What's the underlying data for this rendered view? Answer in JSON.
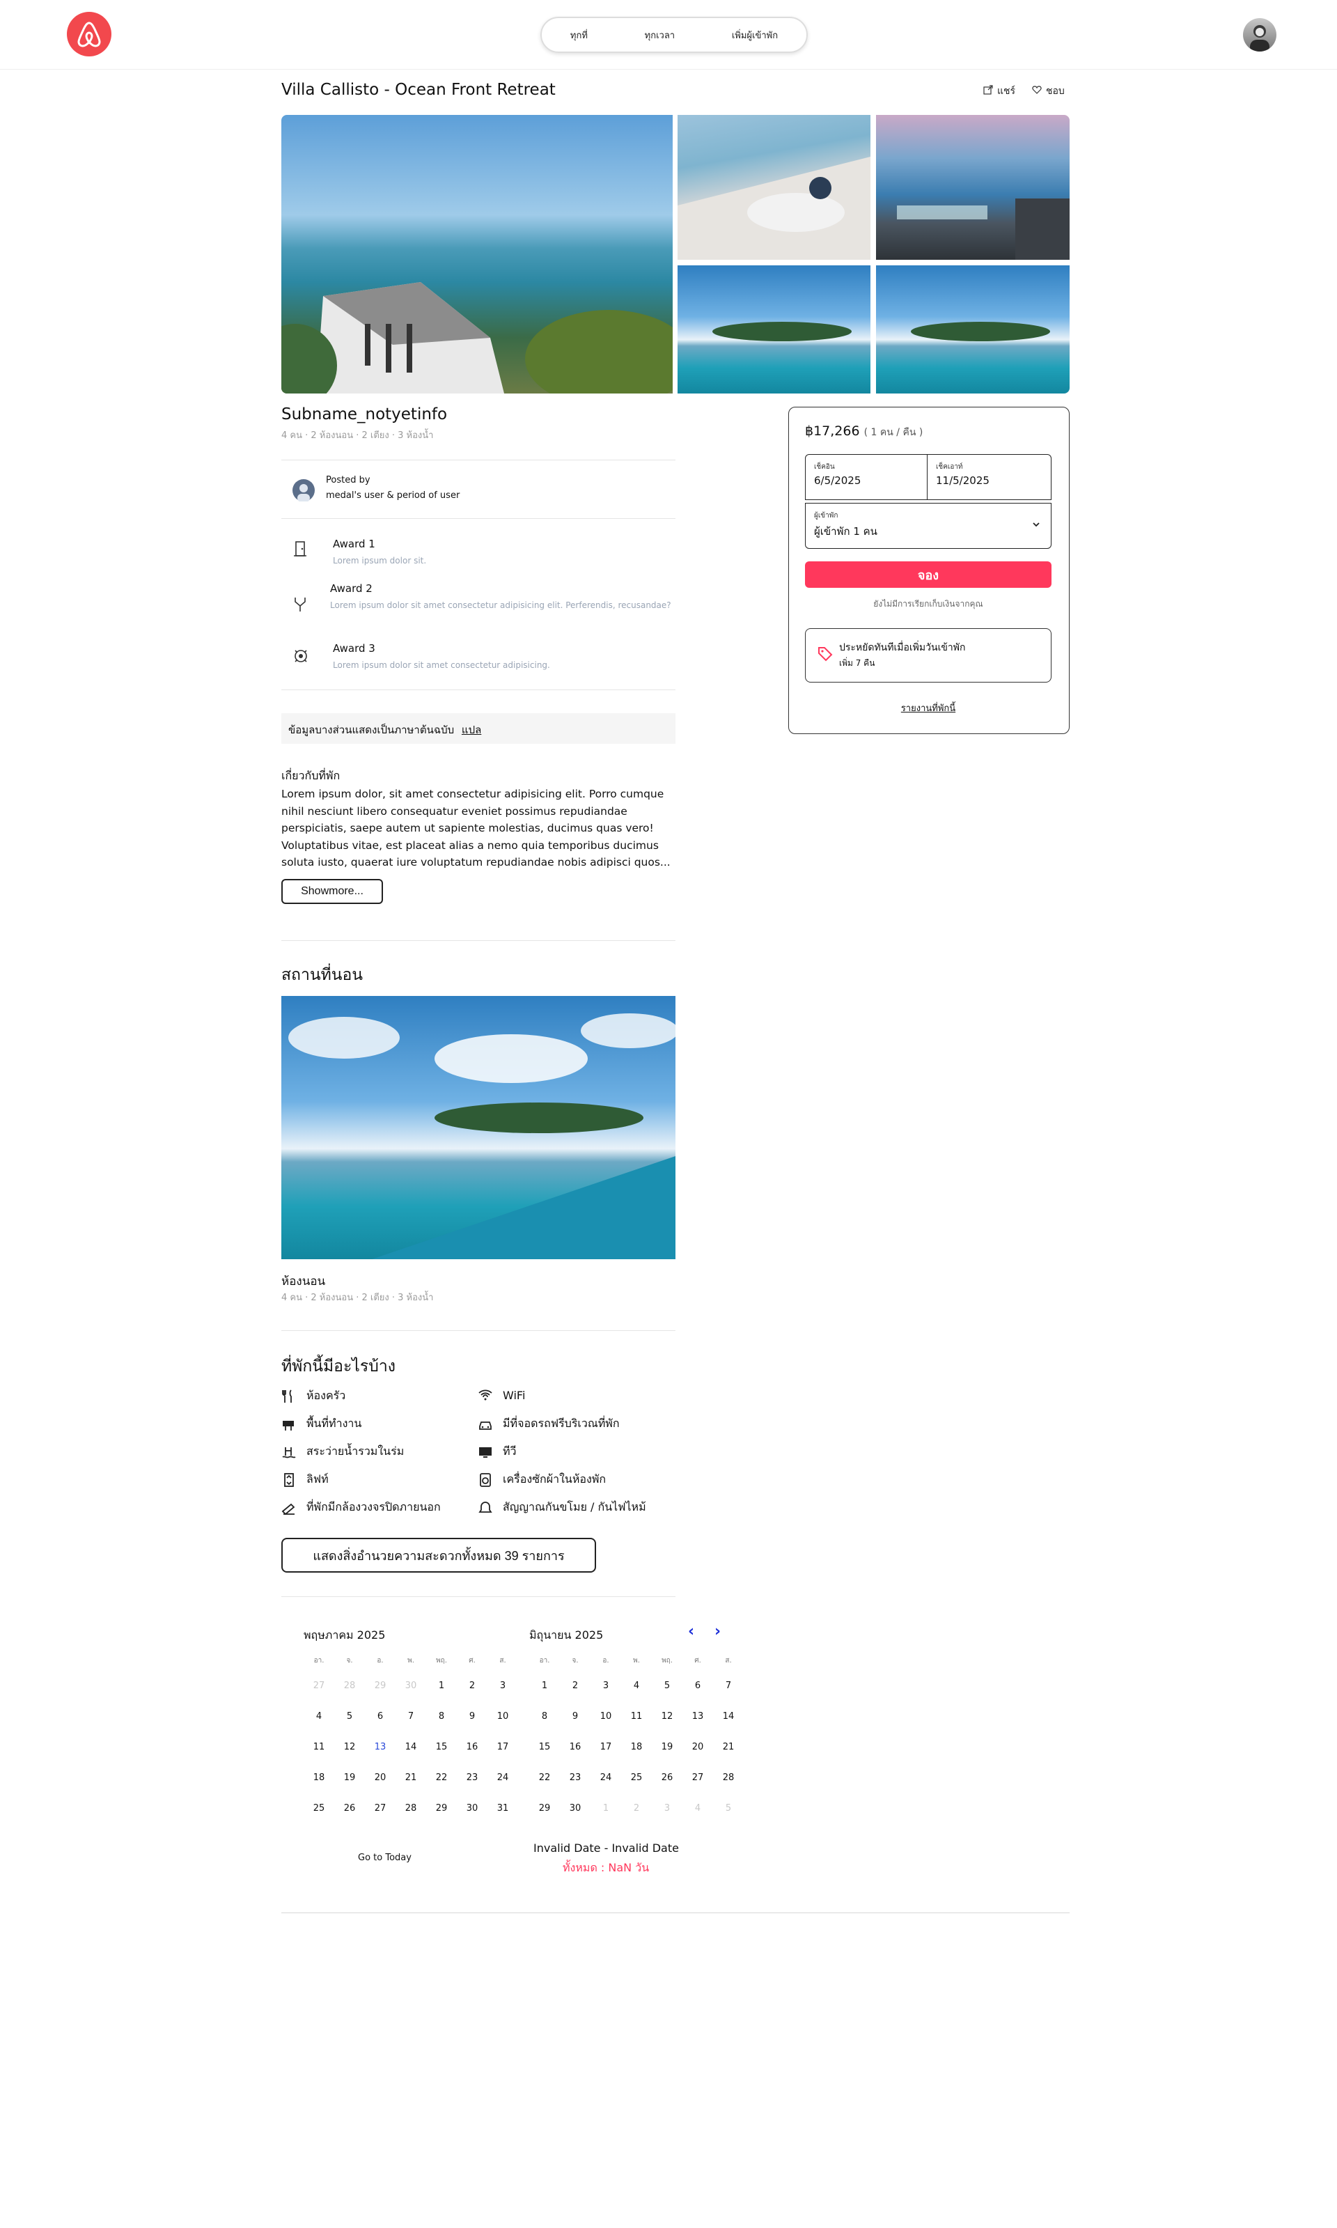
{
  "header": {
    "search": {
      "anywhere": "ทุกที่",
      "anytime": "ทุกเวลา",
      "add_guests": "เพิ่มผู้เข้าพัก"
    }
  },
  "listing": {
    "title": "Villa Callisto - Ocean Front Retreat",
    "share_label": "แชร์",
    "like_label": "ชอบ",
    "subname": "Subname_notyetinfo",
    "summary": "4 คน · 2 ห้องนอน · 2 เตียง · 3 ห้องน้ำ",
    "posted_by_label": "Posted by",
    "posted_by_value": "medal's user & period of user",
    "awards": [
      {
        "title": "Award 1",
        "desc": "Lorem ipsum dolor sit."
      },
      {
        "title": "Award 2",
        "desc": "Lorem ipsum dolor sit amet consectetur adipisicing elit. Perferendis, recusandae?"
      },
      {
        "title": "Award 3",
        "desc": "Lorem ipsum dolor sit amet consectetur adipisicing."
      }
    ],
    "translate_notice": "ข้อมูลบางส่วนแสดงเป็นภาษาต้นฉบับ",
    "translate_link": "แปล",
    "about_title": "เกี่ยวกับที่พัก",
    "about_text": "Lorem ipsum dolor, sit amet consectetur adipisicing elit. Porro cumque nihil nesciunt libero consequatur eveniet possimus repudiandae perspiciatis, saepe autem ut sapiente molestias, ducimus quas vero! Voluptatibus vitae, est placeat alias a nemo quia temporibus ducimus soluta iusto, quaerat iure voluptatum repudiandae nobis adipisci quos...",
    "show_more": "Showmore...",
    "sleeping_title": "สถานที่นอน",
    "bedroom_label": "ห้องนอน",
    "bedroom_summary": "4 คน · 2 ห้องนอน · 2 เตียง · 3 ห้องน้ำ",
    "amenities_title": "ที่พักนี้มีอะไรบ้าง",
    "amenities": [
      {
        "label": "ห้องครัว",
        "icon": "kitchen-icon"
      },
      {
        "label": "WiFi",
        "icon": "wifi-icon"
      },
      {
        "label": "พื้นที่ทำงาน",
        "icon": "workspace-icon"
      },
      {
        "label": "มีที่จอดรถฟรีบริเวณที่พัก",
        "icon": "car-icon"
      },
      {
        "label": "สระว่ายน้ำรวมในร่ม",
        "icon": "pool-icon"
      },
      {
        "label": "ทีวี",
        "icon": "tv-icon"
      },
      {
        "label": "ลิฟท์",
        "icon": "elevator-icon"
      },
      {
        "label": "เครื่องซักผ้าในห้องพัก",
        "icon": "washer-icon"
      },
      {
        "label": "ที่พักมีกล้องวงจรปิดภายนอก",
        "icon": "camera-icon"
      },
      {
        "label": "สัญญาณกันขโมย / กันไฟไหม้",
        "icon": "alarm-icon"
      }
    ],
    "show_all_amenities": "แสดงสิ่งอำนวยความสะดวกทั้งหมด 39 รายการ"
  },
  "calendar": {
    "weekdays": [
      "อา.",
      "จ.",
      "อ.",
      "พ.",
      "พฤ.",
      "ศ.",
      "ส."
    ],
    "months": [
      {
        "name": "พฤษภาคม 2025",
        "days": [
          "27",
          "28",
          "29",
          "30",
          "1",
          "2",
          "3",
          "4",
          "5",
          "6",
          "7",
          "8",
          "9",
          "10",
          "11",
          "12",
          "13",
          "14",
          "15",
          "16",
          "17",
          "18",
          "19",
          "20",
          "21",
          "22",
          "23",
          "24",
          "25",
          "26",
          "27",
          "28",
          "29",
          "30",
          "31"
        ],
        "dim_indices": [
          0,
          1,
          2,
          3
        ],
        "today_index": 16
      },
      {
        "name": "มิถุนายน 2025",
        "days": [
          "1",
          "2",
          "3",
          "4",
          "5",
          "6",
          "7",
          "8",
          "9",
          "10",
          "11",
          "12",
          "13",
          "14",
          "15",
          "16",
          "17",
          "18",
          "19",
          "20",
          "21",
          "22",
          "23",
          "24",
          "25",
          "26",
          "27",
          "28",
          "29",
          "30",
          "1",
          "2",
          "3",
          "4",
          "5"
        ],
        "dim_indices": [
          30,
          31,
          32,
          33,
          34
        ],
        "today_index": -1
      }
    ],
    "go_today": "Go to Today",
    "range_text": "Invalid Date - Invalid Date",
    "total_text": "ทั้งหมด : NaN วัน"
  },
  "booking": {
    "price": "฿17,266",
    "per_night": "( 1 คน / คืน )",
    "checkin_label": "เช็คอิน",
    "checkin_value": "6/5/2025",
    "checkout_label": "เช็คเอาท์",
    "checkout_value": "11/5/2025",
    "guests_label": "ผู้เข้าพัก",
    "guests_value": "ผู้เข้าพัก 1 คน",
    "book_button": "จอง",
    "no_charge": "ยังไม่มีการเรียกเก็บเงินจากคุณ",
    "promo_line1": "ประหยัดทันทีเมื่อเพิ่มวันเข้าพัก",
    "promo_line2": "เพิ่ม 7 คืน",
    "report": "รายงานที่พักนี้"
  },
  "colors": {
    "brand": "#ff385c",
    "accent_blue": "#1d2fd8"
  }
}
